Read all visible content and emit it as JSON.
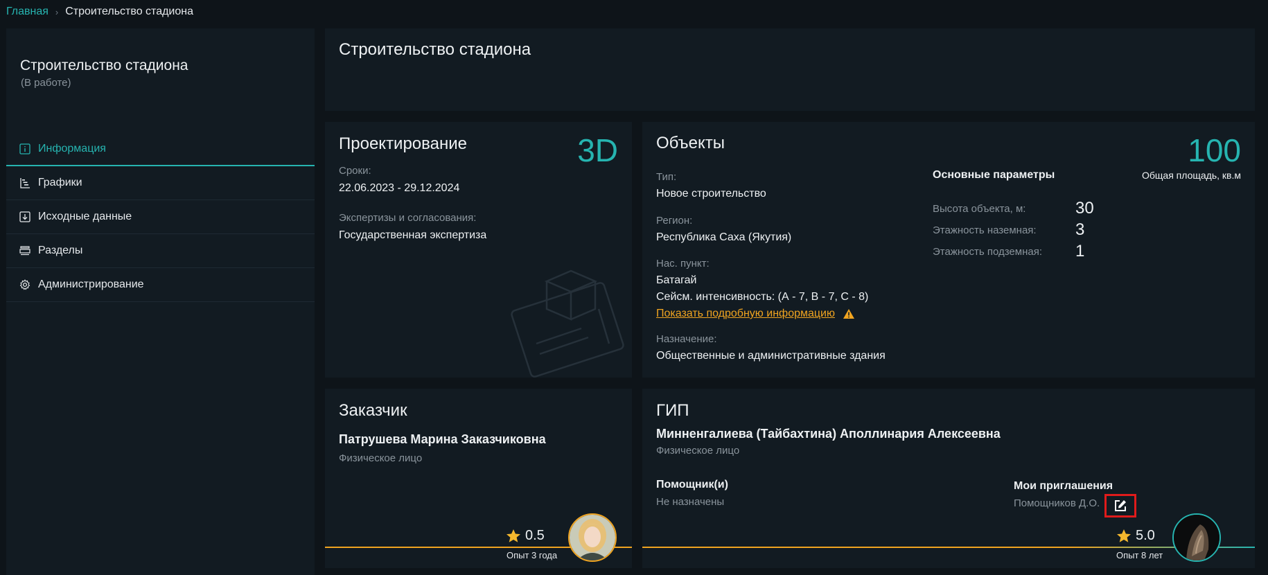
{
  "breadcrumb": {
    "home": "Главная",
    "separator": "›",
    "current": "Строительство стадиона"
  },
  "sidebar": {
    "title": "Строительство стадиона",
    "status": "(В работе)",
    "items": [
      {
        "label": "Информация",
        "icon": "info-icon",
        "active": true
      },
      {
        "label": "Графики",
        "icon": "gantt-chart-icon"
      },
      {
        "label": "Исходные данные",
        "icon": "download-box-icon"
      },
      {
        "label": "Разделы",
        "icon": "sections-icon"
      },
      {
        "label": "Администрирование",
        "icon": "gear-icon"
      }
    ]
  },
  "header_card": {
    "title": "Строительство стадиона"
  },
  "design_card": {
    "title": "Проектирование",
    "badge": "3D",
    "dates_label": "Сроки:",
    "dates_value": "22.06.2023 - 29.12.2024",
    "expertise_label": "Экспертизы и согласования:",
    "expertise_value": "Государственная экспертиза"
  },
  "objects_card": {
    "title": "Объекты",
    "area_value": "100",
    "area_label": "Общая площадь, кв.м",
    "type_label": "Тип:",
    "type_value": "Новое строительство",
    "region_label": "Регион:",
    "region_value": "Республика Саха (Якутия)",
    "locality_label": "Нас. пункт:",
    "locality_value": "Батагай",
    "seismic": "Сейсм. интенсивность: (А - 7, В - 7, С - 8)",
    "details_link": "Показать подробную информацию",
    "purpose_label": "Назначение:",
    "purpose_value": "Общественные и административные здания",
    "params_title": "Основные параметры",
    "params": [
      {
        "label": "Высота объекта, м:",
        "value": "30"
      },
      {
        "label": "Этажность наземная:",
        "value": "3"
      },
      {
        "label": "Этажность подземная:",
        "value": "1"
      }
    ]
  },
  "customer_card": {
    "title": "Заказчик",
    "name": "Патрушева Марина Заказчиковна",
    "type": "Физическое лицо",
    "rating": "0.5",
    "experience": "Опыт 3 года"
  },
  "gip_card": {
    "title": "ГИП",
    "name": "Минненгалиева (Тайбахтина) Аполлинария Алексеевна",
    "type": "Физическое лицо",
    "assistants_label": "Помощник(и)",
    "assistants_value": "Не назначены",
    "invites_label": "Мои приглашения",
    "invites_value": "Помощников Д.О.",
    "rating": "5.0",
    "experience": "Опыт 8 лет"
  },
  "colors": {
    "accent": "#26b4b0",
    "warning": "#f0a420",
    "star": "#f5b82e",
    "customer_line": "#f0a420"
  }
}
